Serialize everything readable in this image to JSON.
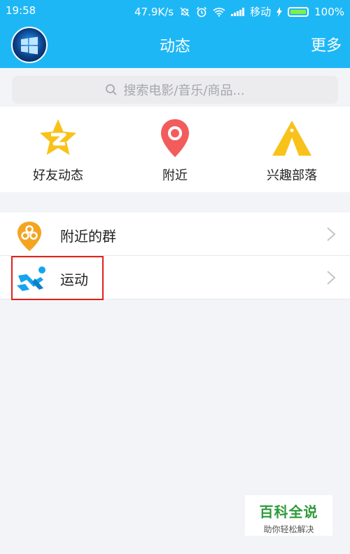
{
  "status_bar": {
    "time": "19:58",
    "speed": "47.9K/s",
    "carrier": "移动",
    "battery": "100%"
  },
  "header": {
    "title": "动态",
    "more_label": "更多"
  },
  "search": {
    "placeholder": "搜索电影/音乐/商品..."
  },
  "quick_actions": [
    {
      "label": "好友动态",
      "icon": "star-icon",
      "color": "#f8c21a"
    },
    {
      "label": "附近",
      "icon": "location-pin-icon",
      "color": "#f25c5c"
    },
    {
      "label": "兴趣部落",
      "icon": "tent-icon",
      "color": "#f8c21a"
    }
  ],
  "list": [
    {
      "label": "附近的群",
      "icon": "group-pin-icon",
      "color": "#f3a521"
    },
    {
      "label": "运动",
      "icon": "running-icon",
      "color": "#14a4f0"
    }
  ],
  "watermark": {
    "title": "百科全说",
    "subtitle": "助你轻松解决"
  },
  "colors": {
    "header": "#1eb7f6",
    "background": "#f3f4f7",
    "highlight": "#e0201b"
  }
}
